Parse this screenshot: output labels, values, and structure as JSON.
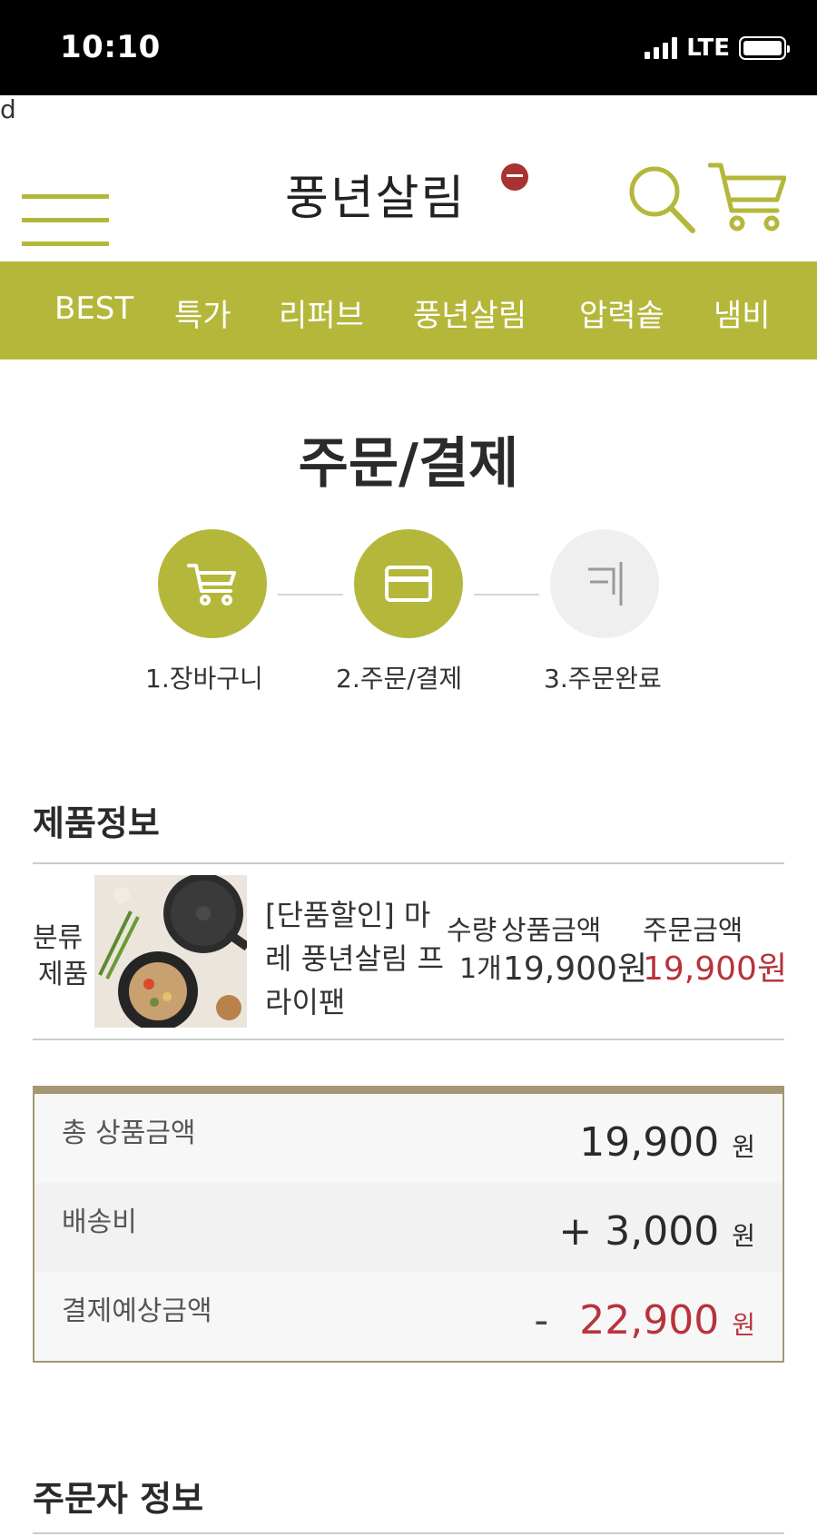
{
  "status_bar": {
    "time": "10:10",
    "network": "LTE"
  },
  "stray_text": "d",
  "header": {
    "logo_text": "풍년살림"
  },
  "nav": {
    "items": [
      "BEST",
      "특가",
      "리퍼브",
      "풍년살림",
      "압력솥",
      "냄비"
    ]
  },
  "page_title": "주문/결제",
  "steps": [
    {
      "label": "1.장바구니",
      "icon": "cart-icon",
      "state": "done"
    },
    {
      "label": "2.주문/결제",
      "icon": "card-icon",
      "state": "current"
    },
    {
      "label": "3.주문완료",
      "icon": "flag-icon",
      "state": "pending"
    }
  ],
  "product_section": {
    "title": "제품정보",
    "col_category": "분류",
    "category_value": "제품",
    "product_name": "[단품할인] 마레 풍년살림 프라이팬",
    "col_qty": "수량",
    "col_price": "상품금액",
    "col_order": "주문금액",
    "qty": "1개",
    "price": "19,900원",
    "order_price": "19,900원"
  },
  "summary": {
    "subtotal_label": "총 상품금액",
    "subtotal_value": "19,900",
    "shipping_label": "배송비",
    "shipping_sign": "+",
    "shipping_value": "3,000",
    "expected_label": "결제예상금액",
    "expected_sign": "-",
    "expected_value": "22,900",
    "won": "원"
  },
  "orderer_section": {
    "title": "주문자 정보"
  },
  "colors": {
    "accent": "#b5b73b",
    "price_red": "#b7343c",
    "summary_border": "#a39874"
  }
}
